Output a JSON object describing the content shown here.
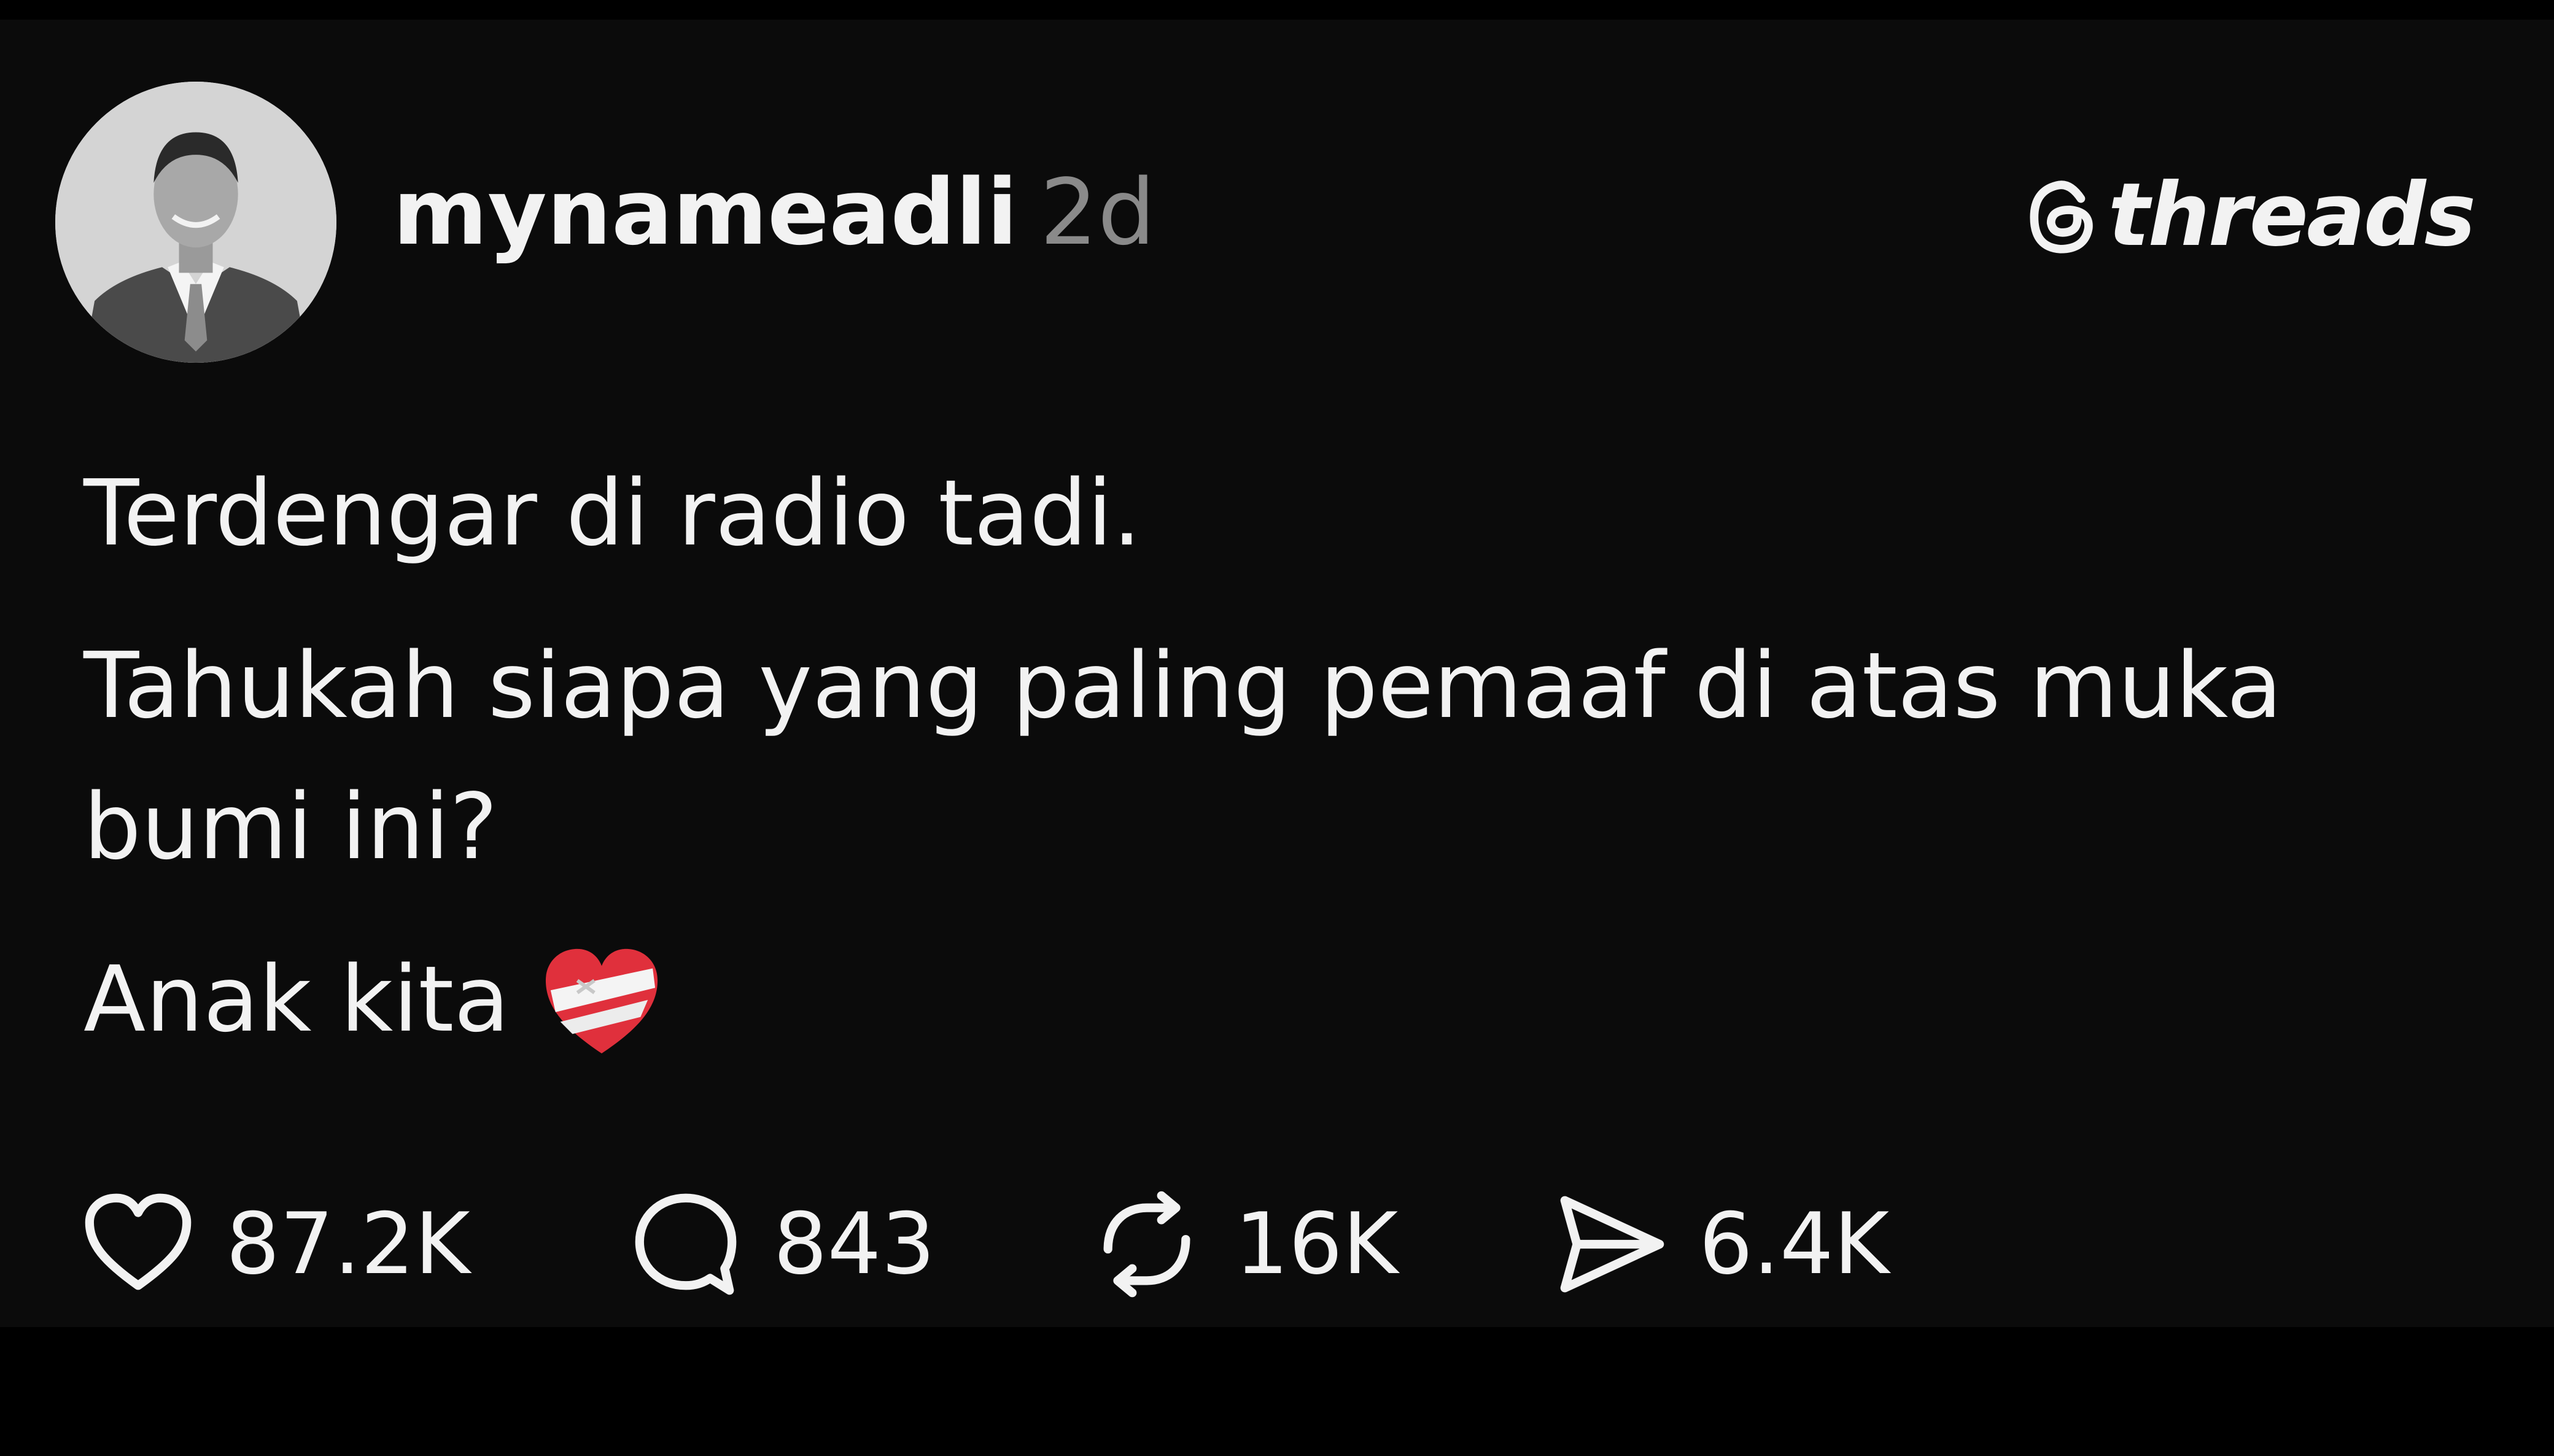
{
  "post": {
    "author": {
      "username": "mynameadli",
      "timestamp": "2d",
      "avatar_icon": "profile-photo"
    },
    "brand": {
      "icon": "threads-logo-icon",
      "label": "threads"
    },
    "paragraphs": [
      "Terdengar di radio tadi.",
      "Tahukah siapa yang paling pemaaf di atas muka bumi ini?",
      "Anak kita"
    ],
    "emoji": "mending-heart",
    "actions": {
      "likes": {
        "icon": "heart-icon",
        "count": "87.2K"
      },
      "replies": {
        "icon": "comment-icon",
        "count": "843"
      },
      "reposts": {
        "icon": "repost-icon",
        "count": "16K"
      },
      "shares": {
        "icon": "send-icon",
        "count": "6.4K"
      }
    }
  },
  "colors": {
    "background": "#000000",
    "card": "#0b0b0b",
    "text": "#f2f2f2",
    "muted": "#8a8a8a",
    "emoji_red": "#e0303c"
  }
}
